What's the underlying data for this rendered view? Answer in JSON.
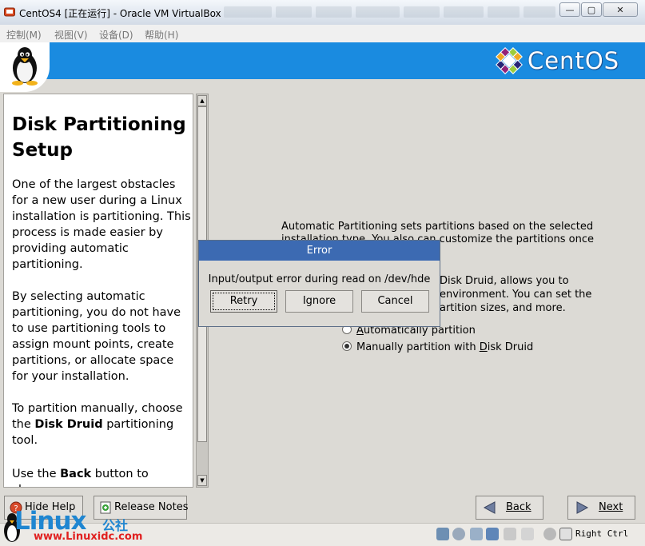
{
  "window": {
    "title": "CentOS4 [正在运行] - Oracle VM VirtualBox",
    "controls": {
      "minimize": "—",
      "restore": "▢",
      "close": "✕"
    }
  },
  "menubar": {
    "items": [
      "控制(M)",
      "视图(V)",
      "设备(D)",
      "帮助(H)"
    ]
  },
  "header": {
    "brand": "CentOS"
  },
  "help": {
    "title": "Disk Partitioning Setup",
    "p1": "One of the largest obstacles for a new user during a Linux installation is partitioning. This process is made easier by providing automatic partitioning.",
    "p2": "By selecting automatic partitioning, you do not have to use partitioning tools to assign mount points, create partitions, or allocate space for your installation.",
    "p3_pre": "To partition manually, choose the ",
    "p3_bold": "Disk Druid",
    "p3_post": " partitioning tool.",
    "p4_pre": "Use the ",
    "p4_bold": "Back",
    "p4_post": " button to choose"
  },
  "main": {
    "line1": "Automatic Partitioning sets partitions based on the selected",
    "line2": "installation type. You also can customize the partitions once",
    "line3": "Disk Druid, allows you to",
    "line4": "environment. You can set the",
    "line5": "artition sizes, and more.",
    "options": [
      {
        "label_pre": "",
        "label_u": "A",
        "label_post": "utomatically partition",
        "selected": false
      },
      {
        "label_pre": "Manually partition with ",
        "label_u": "D",
        "label_post": "isk Druid",
        "selected": true
      }
    ]
  },
  "dialog": {
    "title": "Error",
    "message": "Input/output error during read on /dev/hde",
    "buttons": [
      "Retry",
      "Ignore",
      "Cancel"
    ]
  },
  "buttons": {
    "hide_help": "Hide Help",
    "release_notes": "Release Notes",
    "back": "Back",
    "next": "Next"
  },
  "statusbar": {
    "host_key": "Right Ctrl"
  },
  "watermark": {
    "logo": "Linux",
    "cn": "公社",
    "url": "www.Linuxidc.com"
  },
  "colors": {
    "header_blue": "#1a8be0",
    "dialog_title": "#3c6ab2"
  }
}
